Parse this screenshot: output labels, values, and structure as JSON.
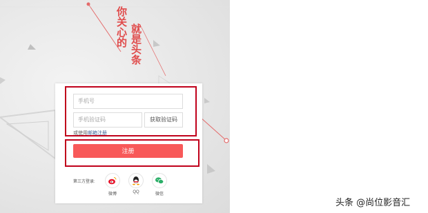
{
  "slogan": {
    "line1": "你关心的",
    "line2": "就是头条"
  },
  "form": {
    "phone_placeholder": "手机号",
    "code_placeholder": "手机验证码",
    "get_code_label": "获取验证码",
    "email_prefix": "或使用",
    "email_link": "邮箱注册",
    "register_label": "注册"
  },
  "third_party": {
    "label": "第三方登录:",
    "items": [
      {
        "label": "微博",
        "icon": "weibo-icon"
      },
      {
        "label": "QQ",
        "icon": "qq-icon"
      },
      {
        "label": "微信",
        "icon": "wechat-icon"
      }
    ]
  },
  "watermark": "头条 @尚位影音汇",
  "colors": {
    "accent": "#f85959",
    "slogan": "#e04b4b",
    "highlight": "#c0001a",
    "link": "#406599"
  }
}
